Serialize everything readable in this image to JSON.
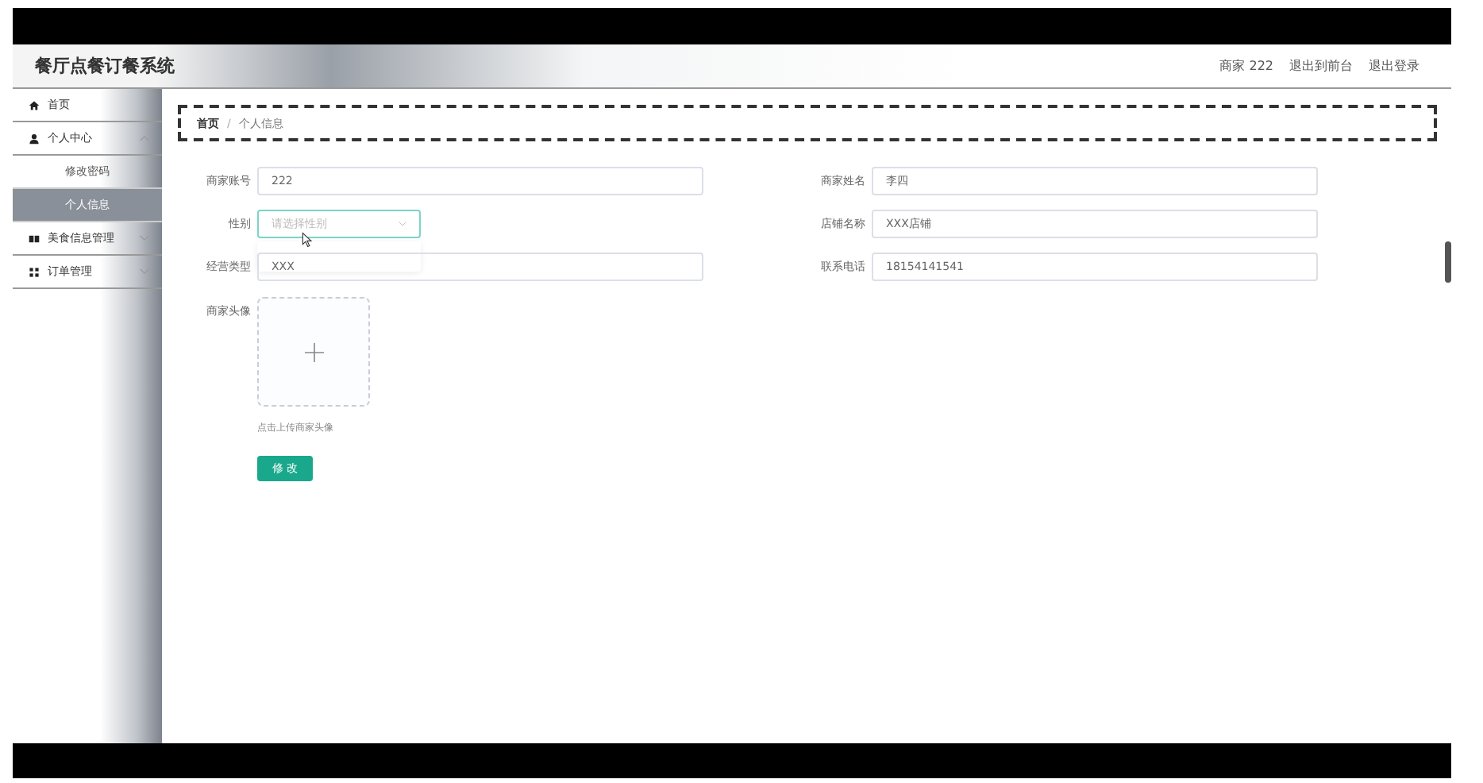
{
  "app": {
    "title": "餐厅点餐订餐系统"
  },
  "header_links": [
    {
      "text": "商家 222"
    },
    {
      "text": "退出到前台"
    },
    {
      "text": "退出登录"
    }
  ],
  "sidebar": {
    "items": [
      {
        "label": "首页",
        "kind": "link",
        "selected": false
      },
      {
        "label": "个人中心",
        "kind": "menu",
        "expanded": true,
        "selected": false,
        "children": [
          {
            "label": "修改密码",
            "selected": false
          },
          {
            "label": "个人信息",
            "selected": true
          }
        ]
      },
      {
        "label": "美食信息管理",
        "kind": "menu",
        "expanded": false,
        "selected": false
      },
      {
        "label": "订单管理",
        "kind": "menu",
        "expanded": false,
        "selected": false
      }
    ]
  },
  "breadcrumb": {
    "items": [
      "首页",
      "个人信息"
    ],
    "separator": "/"
  },
  "form": {
    "left": [
      {
        "label": "商家账号",
        "kind": "input",
        "value": "222"
      },
      {
        "label": "性别",
        "kind": "select",
        "placeholder": "请选择性别",
        "open": true
      },
      {
        "label": "经营类型",
        "kind": "input",
        "value": "XXX"
      }
    ],
    "right": [
      {
        "label": "商家姓名",
        "kind": "input",
        "value": "李四"
      },
      {
        "label": "店铺名称",
        "kind": "input",
        "value": "XXX店铺"
      },
      {
        "label": "联系电话",
        "kind": "input",
        "value": "18154141541"
      }
    ],
    "avatar": {
      "label": "商家头像",
      "hint": "点击上传商家头像"
    },
    "submit": "修 改"
  }
}
